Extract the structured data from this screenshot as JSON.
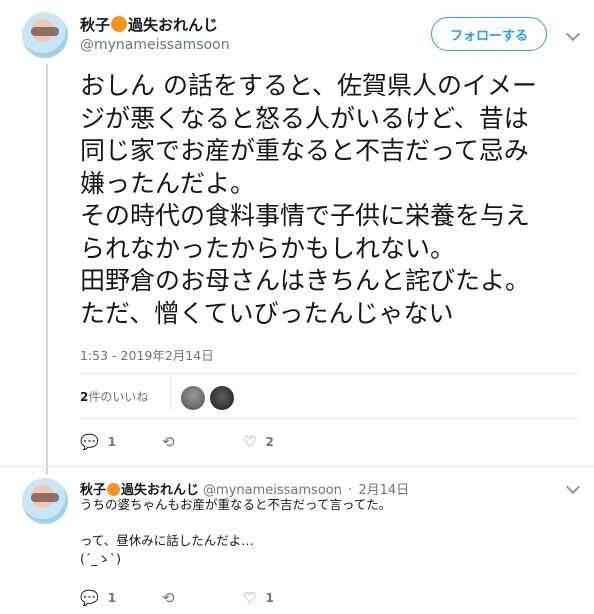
{
  "tweet": {
    "author": {
      "name_part1": "秋子",
      "name_part2": "過失おれんじ",
      "handle": "@mynameissamsoon"
    },
    "follow_label": "フォローする",
    "text_lines": [
      "おしん の話をすると、佐賀県人のイメー",
      "ジが悪くなると怒る人がいるけど、昔は",
      "同じ家でお産が重なると不吉だって忌み",
      "嫌ったんだよ。",
      "その時代の食料事情で子供に栄養を与え",
      "られなかったからかもしれない。",
      "田野倉のお母さんはきちんと詫びたよ。",
      "ただ、憎くていびったんじゃない"
    ],
    "timestamp": "1:53 - 2019年2月14日",
    "likes": {
      "count": "2",
      "label": "件のいいね"
    },
    "actions": {
      "reply_count": "1",
      "retweet_count": "",
      "like_count": "2"
    }
  },
  "reply": {
    "author": {
      "name_part1": "秋子",
      "name_part2": "過失おれんじ",
      "handle": "@mynameissamsoon"
    },
    "separator": "·",
    "date": "2月14日",
    "text_lines": [
      "うちの婆ちゃんもお産が重なると不吉だって言ってた。",
      "",
      "って、昼休みに話したんだよ…",
      "(´_ゝ`)"
    ],
    "actions": {
      "reply_count": "1",
      "retweet_count": "",
      "like_count": "1"
    }
  },
  "icons": {
    "reply": "💬",
    "retweet": "⟲",
    "like": "♡",
    "orange": "orange-emoji-icon"
  },
  "colors": {
    "accent": "#1da1f2",
    "secondary_text": "#657786",
    "divider": "#e6ecf0"
  }
}
